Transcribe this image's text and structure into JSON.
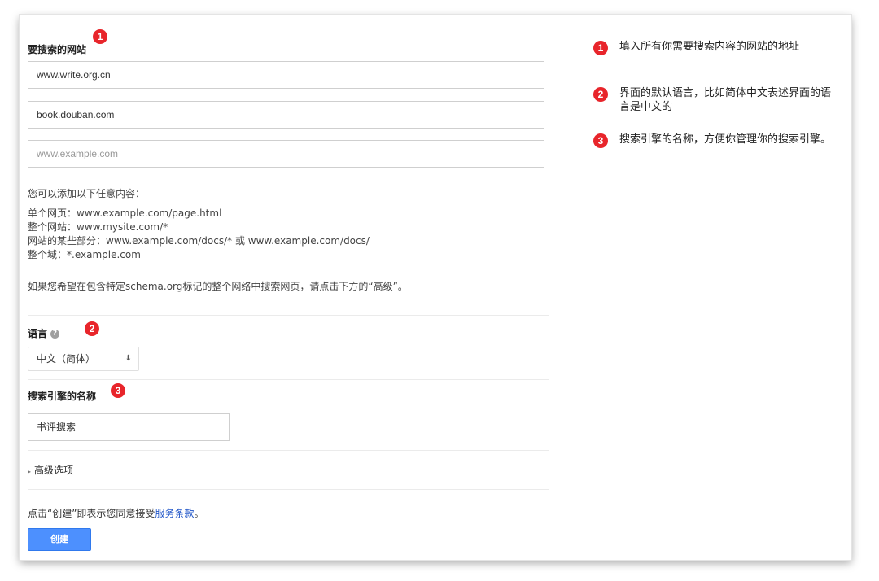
{
  "form": {
    "sites": {
      "title": "要搜索的网站",
      "badge": "1",
      "fields": [
        {
          "value": "www.write.org.cn",
          "placeholder": ""
        },
        {
          "value": "book.douban.com",
          "placeholder": ""
        },
        {
          "value": "",
          "placeholder": "www.example.com"
        }
      ],
      "hint_intro": "您可以添加以下任意内容：",
      "hint_lines": [
        "单个网页：www.example.com/page.html",
        "整个网站：www.mysite.com/*",
        "网站的某些部分：www.example.com/docs/* 或 www.example.com/docs/",
        "整个域：*.example.com"
      ],
      "schema_hint": "如果您希望在包含特定schema.org标记的整个网络中搜索网页，请点击下方的“高级”。"
    },
    "language": {
      "title": "语言",
      "help_icon": "?",
      "badge": "2",
      "selected": "中文（简体）",
      "arrows": "⬍"
    },
    "engine_name": {
      "title": "搜索引擎的名称",
      "badge": "3",
      "value": "书评搜索"
    },
    "advanced": {
      "arrow": "▸",
      "label": "高级选项"
    },
    "terms": {
      "prefix": "点击“创建”即表示您同意接受",
      "link": "服务条款",
      "suffix": "。"
    },
    "create_button": "创建"
  },
  "notes": [
    {
      "badge": "1",
      "text": "填入所有你需要搜索内容的网站的地址"
    },
    {
      "badge": "2",
      "text": "界面的默认语言，比如简体中文表述界面的语言是中文的"
    },
    {
      "badge": "3",
      "text": "搜索引擎的名称，方便你管理你的搜索引擎。"
    }
  ],
  "colors": {
    "badge": "#e8252b",
    "button": "#4d90fe",
    "link": "#2156c8"
  }
}
